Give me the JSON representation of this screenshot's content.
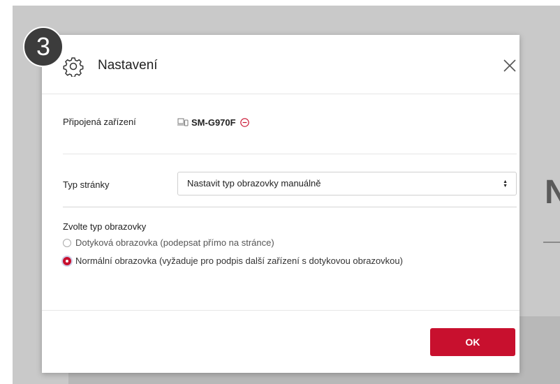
{
  "step": {
    "number": "3"
  },
  "dialog": {
    "title": "Nastavení",
    "icons": {
      "header": "gear-icon",
      "close": "close-icon",
      "device": "devices-icon",
      "remove": "remove-circle-icon"
    },
    "connected_devices": {
      "label": "Připojená zařízení",
      "device_name": "SM-G970F"
    },
    "page_type": {
      "label": "Typ stránky",
      "selected": "Nastavit typ obrazovky manuálně"
    },
    "screen_type": {
      "label": "Zvolte typ obrazovky",
      "options": [
        {
          "label": "Dotyková obrazovka (podepsat přímo na stránce)",
          "selected": false
        },
        {
          "label": "Normální obrazovka (vyžaduje pro podpis další zařízení s dotykovou obrazovkou)",
          "selected": true
        }
      ]
    },
    "ok_label": "OK"
  },
  "colors": {
    "accent": "#c8102e",
    "overlay": "#c9c9c9"
  }
}
